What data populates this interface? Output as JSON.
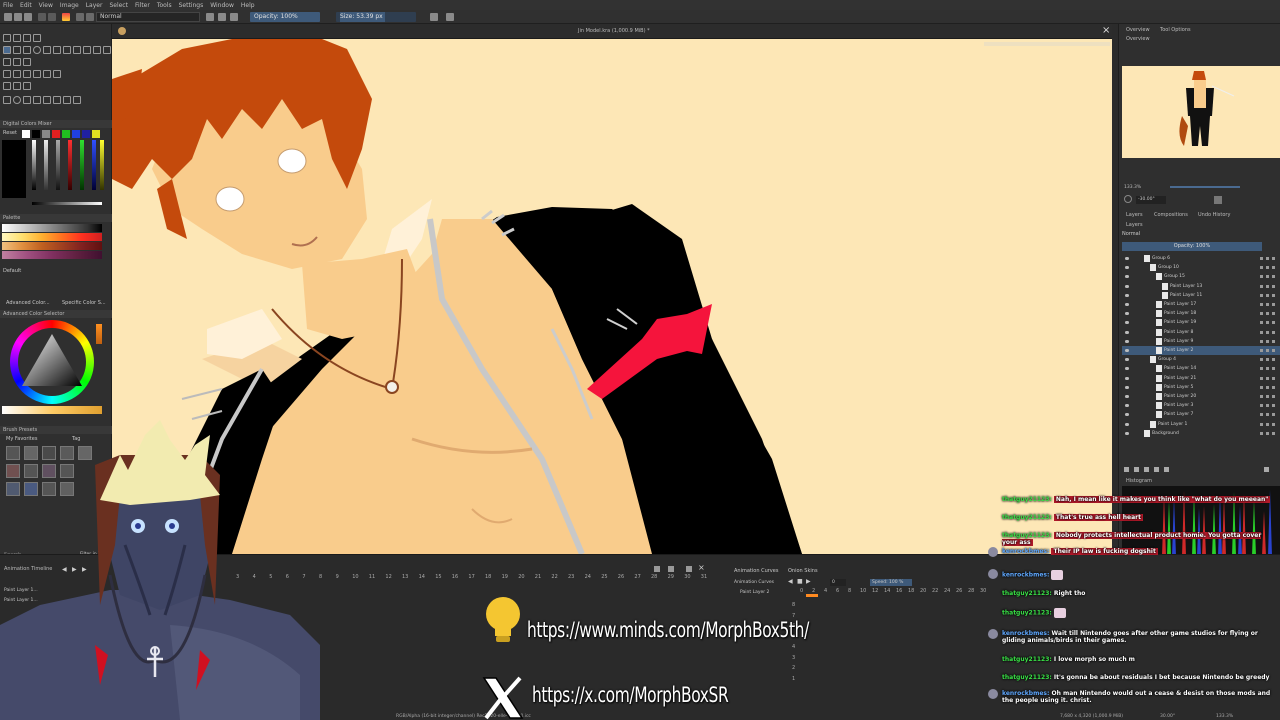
{
  "menu": [
    "File",
    "Edit",
    "View",
    "Image",
    "Layer",
    "Select",
    "Filter",
    "Tools",
    "Settings",
    "Window",
    "Help"
  ],
  "toolbar": {
    "blend_mode": "Normal",
    "opacity": "Opacity: 100%",
    "size": "Size: 53.39 px"
  },
  "document": {
    "title": "Jin Model.kra (1,000.9 MiB) *"
  },
  "left_panels": {
    "color_mixer": "Digital Colors Mixer",
    "reset": "Reset",
    "palette": "Palette",
    "palette_name": "Default",
    "advanced_color": "Advanced Color...",
    "specific_color": "Specific Color S...",
    "advanced_color_selector": "Advanced Color Selector",
    "brush_presets": "Brush Presets",
    "my_favorites": "My Favorites",
    "tag": "Tag",
    "search": "Search",
    "filter_in_tag": "Filter in Tag"
  },
  "right_panels": {
    "tabs_top": [
      "Overview",
      "Tool Options"
    ],
    "overview": "Overview",
    "zoom_value": "133.3%",
    "rotation_value": "-30.00°",
    "tabs_mid": [
      "Layers",
      "Compositions",
      "Undo History"
    ],
    "layers_title": "Layers",
    "blend": "Normal",
    "opacity": "Opacity: 100%",
    "histogram": "Histogram"
  },
  "layers": [
    {
      "name": "Group 6",
      "indent": 0
    },
    {
      "name": "Group 10",
      "indent": 1
    },
    {
      "name": "Group 15",
      "indent": 2
    },
    {
      "name": "Paint Layer 13",
      "indent": 3
    },
    {
      "name": "Paint Layer 11",
      "indent": 3
    },
    {
      "name": "Paint Layer 17",
      "indent": 2
    },
    {
      "name": "Paint Layer 18",
      "indent": 2
    },
    {
      "name": "Paint Layer 19",
      "indent": 2
    },
    {
      "name": "Paint Layer 8",
      "indent": 2
    },
    {
      "name": "Paint Layer 9",
      "indent": 2
    },
    {
      "name": "Paint Layer 2",
      "indent": 2,
      "selected": true
    },
    {
      "name": "Group 4",
      "indent": 1
    },
    {
      "name": "Paint Layer 14",
      "indent": 2
    },
    {
      "name": "Paint Layer 21",
      "indent": 2
    },
    {
      "name": "Paint Layer 5",
      "indent": 2
    },
    {
      "name": "Paint Layer 20",
      "indent": 2
    },
    {
      "name": "Paint Layer 3",
      "indent": 2
    },
    {
      "name": "Paint Layer 7",
      "indent": 2
    },
    {
      "name": "Paint Layer 1",
      "indent": 1
    },
    {
      "name": "Background",
      "indent": 0
    }
  ],
  "timeline": {
    "title": "Animation Timeline",
    "layer_rows": [
      "Paint Layer 1...",
      "Paint Layer 1..."
    ],
    "frame_numbers": [
      "3",
      "4",
      "5",
      "6",
      "7",
      "8",
      "9",
      "10",
      "11",
      "12",
      "13",
      "14",
      "15",
      "16",
      "17",
      "18",
      "19",
      "20",
      "21",
      "22",
      "23",
      "24",
      "25",
      "26",
      "27",
      "28",
      "29",
      "30",
      "31"
    ],
    "curves_title": "Animation Curves",
    "onion_title": "Onion Skins",
    "curves_label": "Animation Curves",
    "curves_layer": "Paint Layer 2",
    "frame_field": "0",
    "speed": "Speed: 100 %",
    "curves_numbers": [
      "0",
      "2",
      "4",
      "6",
      "8",
      "10",
      "12",
      "14",
      "16",
      "18",
      "20",
      "22",
      "24",
      "26",
      "28",
      "30"
    ],
    "curve_axis": [
      "8",
      "7",
      "6",
      "5",
      "4",
      "3",
      "2",
      "1"
    ]
  },
  "statusbar": {
    "color_space": "RGB/Alpha (16-bit integer/channel) Rec2020-elle-V4-g10.icc",
    "dims": "7,680 x 4,320 (1,000.9 MiB)",
    "rotation": "30.00°",
    "zoom": "133.3%"
  },
  "links": {
    "minds": "https://www.minds.com/MorphBox5th/",
    "x": "https://x.com/MorphBoxSR"
  },
  "chat": [
    {
      "user": "thatguy21123",
      "text": "Nah, I mean like it makes you think like \"what do you meeean\"",
      "highlight": true
    },
    {
      "user": "thatguy21123",
      "text": "That's true ass hell heart",
      "highlight": true
    },
    {
      "user": "thatguy21123",
      "text": "Nobody protects intellectual product homie. You gotta cover your ass",
      "highlight": true
    },
    {
      "user": "kenrockbmes",
      "text": "Their IP law is fucking dogshit",
      "highlight": true,
      "cyan": true
    },
    {
      "user": "kenrockbmes",
      "text": "",
      "cyan": true
    },
    {
      "user": "thatguy21123",
      "text": "Right tho"
    },
    {
      "user": "thatguy21123",
      "text": ""
    },
    {
      "user": "kenrockbmes",
      "text": "Wait till Nintendo goes after other game studios for flying or gliding animals/birds in their games.",
      "cyan": true
    },
    {
      "user": "thatguy21123",
      "text": "I love morph so much m"
    },
    {
      "user": "thatguy21123",
      "text": "It's gonna be about residuals I bet because Nintendo be greedy"
    },
    {
      "user": "kenrockbmes",
      "text": "Oh man Nintendo would out a cease & desist on those mods and the people using it. christ.",
      "cyan": true
    }
  ]
}
